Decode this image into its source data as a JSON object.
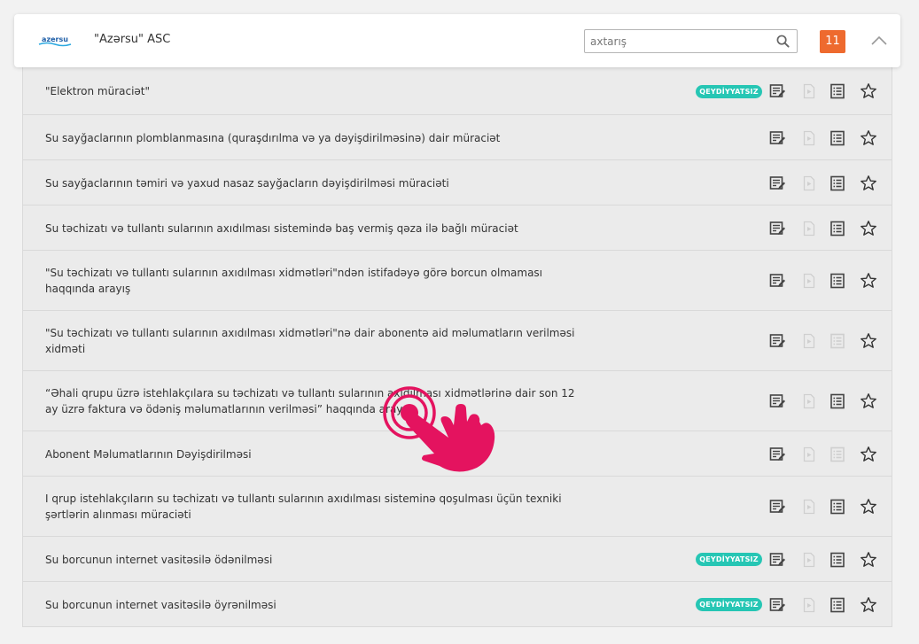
{
  "header": {
    "logo_text": "azersu",
    "org_name": "\"Azərsu\" ASC",
    "search_placeholder": "axtarış",
    "count": "11"
  },
  "colors": {
    "accent_orange": "#ee6a2e",
    "badge_teal": "#26c6b4",
    "icon_active": "#444444",
    "icon_disabled": "#cfcfcf",
    "cursor_pink": "#e4135f"
  },
  "services": [
    {
      "title": "\"Elektron müraciət\"",
      "badge": "QEYDİYYATSIZ",
      "list_enabled": true
    },
    {
      "title": "Su sayğaclarının plomblanmasına (quraşdırılma və ya dəyişdirilməsinə) dair müraciət",
      "badge": "",
      "list_enabled": true
    },
    {
      "title": "Su sayğaclarının təmiri və yaxud nasaz sayğacların dəyişdirilməsi müraciəti",
      "badge": "",
      "list_enabled": true
    },
    {
      "title": "Su təchizatı və tullantı sularının axıdılması sistemində baş vermiş qəza ilə bağlı müraciət",
      "badge": "",
      "list_enabled": true
    },
    {
      "title": "\"Su təchizatı və tullantı sularının axıdılması xidmətləri\"ndən istifadəyə görə borcun olmaması haqqında arayış",
      "badge": "",
      "list_enabled": true
    },
    {
      "title": "\"Su təchizatı və tullantı sularının axıdılması xidmətləri\"nə dair abonentə aid məlumatların verilməsi xidməti",
      "badge": "",
      "list_enabled": false
    },
    {
      "title": "“Əhali qrupu üzrə istehlakçılara su təchizatı və tullantı sularının axıdılması xidmətlərinə dair son 12 ay üzrə faktura və ödəniş məlumatlarının verilməsi” haqqında arayış",
      "badge": "",
      "list_enabled": true
    },
    {
      "title": "Abonent Məlumatlarının Dəyişdirilməsi",
      "badge": "",
      "list_enabled": false
    },
    {
      "title": "I qrup istehlakçıların su təchizatı və tullantı sularının axıdılması sisteminə qoşulması üçün texniki şərtlərin alınması müraciəti",
      "badge": "",
      "list_enabled": true
    },
    {
      "title": "Su borcunun internet vasitəsilə ödənilməsi",
      "badge": "QEYDİYYATSIZ",
      "list_enabled": true
    },
    {
      "title": "Su borcunun internet vasitəsilə öyrənilməsi",
      "badge": "QEYDİYYATSIZ",
      "list_enabled": true
    }
  ]
}
